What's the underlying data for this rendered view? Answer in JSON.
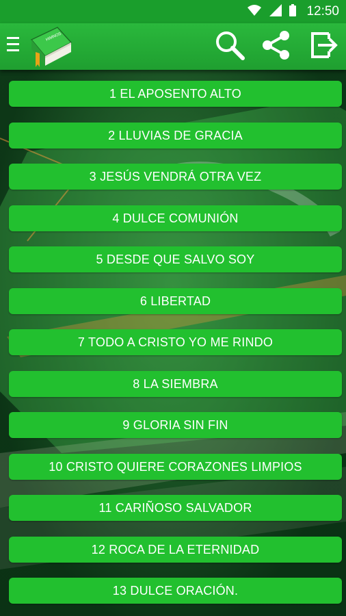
{
  "status": {
    "time": "12:50"
  },
  "toolbar": {
    "logo": "bible-book-logo",
    "icons": [
      "menu-icon",
      "search-icon",
      "share-icon",
      "exit-icon"
    ]
  },
  "hymns": [
    "1 EL APOSENTO ALTO",
    "2 LLUVIAS DE GRACIA",
    "3 JESÚS VENDRÁ OTRA VEZ",
    "4 DULCE COMUNIÓN",
    "5 DESDE QUE SALVO SOY",
    "6 LIBERTAD",
    "7 TODO A CRISTO YO ME RINDO",
    "8 LA SIEMBRA",
    "9 GLORIA SIN FIN",
    "10 CRISTO QUIERE CORAZONES LIMPIOS",
    "11 CARIÑOSO SALVADOR",
    "12 ROCA DE LA ETERNIDAD",
    "13 DULCE ORACIÓN."
  ],
  "colors": {
    "accent": "#22c02f",
    "toolbar": "#1f9f30"
  }
}
